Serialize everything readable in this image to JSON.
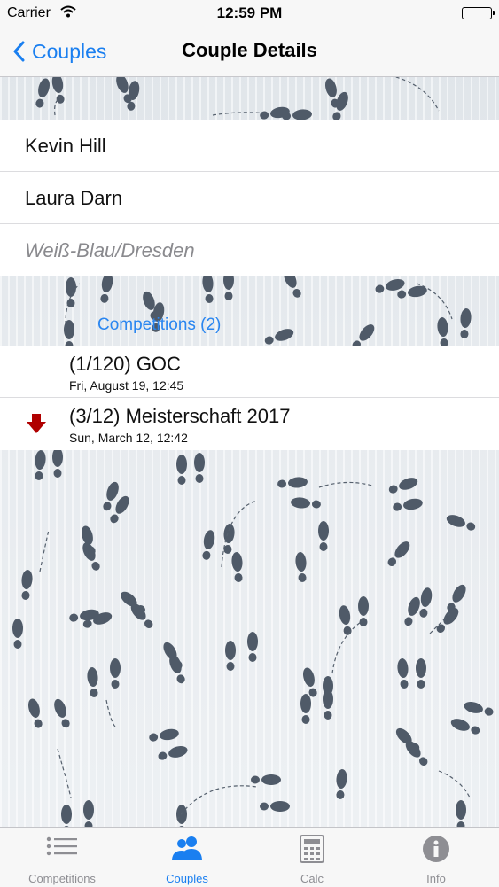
{
  "status_bar": {
    "carrier": "Carrier",
    "time": "12:59 PM"
  },
  "nav": {
    "back_label": "Couples",
    "title": "Couple Details"
  },
  "couple": {
    "partner1": "Kevin Hill",
    "partner2": "Laura Darn",
    "club": "Weiß-Blau/Dresden"
  },
  "competitions": {
    "header": "Competitions (2)",
    "items": [
      {
        "name": "(1/120) GOC",
        "date": "Fri, August 19, 12:45",
        "arrow": false
      },
      {
        "name": "(3/12) Meisterschaft 2017",
        "date": "Sun, March 12, 12:42",
        "arrow": true,
        "arrow_color": "#b00000"
      }
    ]
  },
  "tabbar": {
    "tabs": [
      {
        "label": "Competitions",
        "icon": "list-icon",
        "active": false
      },
      {
        "label": "Couples",
        "icon": "people-icon",
        "active": true
      },
      {
        "label": "Calc",
        "icon": "calculator-icon",
        "active": false
      },
      {
        "label": "Info",
        "icon": "info-icon",
        "active": false
      }
    ]
  },
  "colors": {
    "accent": "#1a7ff0",
    "down_arrow": "#b00000",
    "footprint": "#4f5a68"
  }
}
